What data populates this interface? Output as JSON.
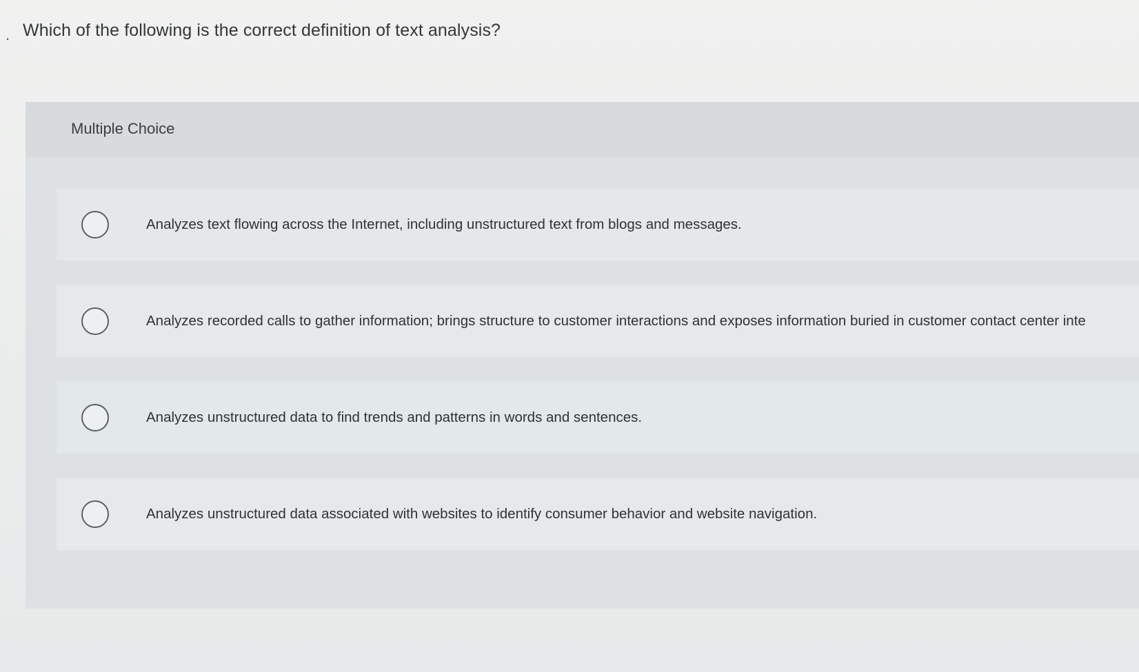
{
  "question": {
    "bullet": ".",
    "text": "Which of the following is the correct definition of text analysis?"
  },
  "panel": {
    "title": "Multiple Choice"
  },
  "options": [
    {
      "label": "Analyzes text flowing across the Internet, including unstructured text from blogs and messages.",
      "selected": false
    },
    {
      "label": "Analyzes recorded calls to gather information; brings structure to customer interactions and exposes information buried in customer contact center inte",
      "selected": false
    },
    {
      "label": "Analyzes unstructured data to find trends and patterns in words and sentences.",
      "selected": false
    },
    {
      "label": "Analyzes unstructured data associated with websites to identify consumer behavior and website navigation.",
      "selected": false
    }
  ]
}
